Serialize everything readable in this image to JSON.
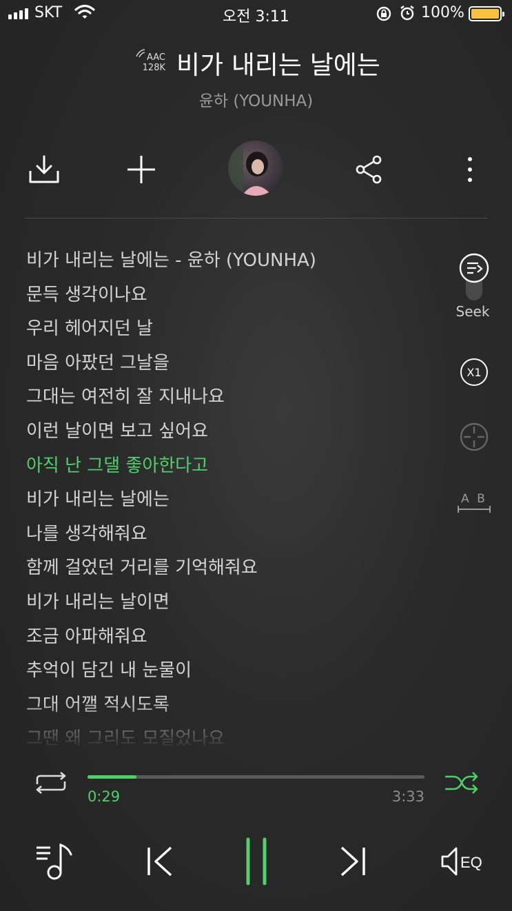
{
  "status_bar": {
    "carrier": "SKT",
    "time": "오전 3:11",
    "battery_percent": "100%",
    "battery_level": 1.0
  },
  "header": {
    "codec_line1": "AAC",
    "codec_line2": "128K",
    "title": "비가 내리는 날에는",
    "artist": "윤하 (YOUNHA)"
  },
  "toolbar": {
    "icons": [
      "download-icon",
      "add-icon",
      "album-art",
      "share-icon",
      "more-icon"
    ]
  },
  "lyrics": {
    "lines": [
      "비가 내리는 날에는 - 윤하 (YOUNHA)",
      "문득 생각이나요",
      "우리 헤어지던 날",
      "마음 아팠던 그날을",
      "그대는 여전히 잘 지내나요",
      "이런 날이면 보고 싶어요",
      "아직 난 그댈 좋아한다고",
      "비가 내리는 날에는",
      "나를 생각해줘요",
      "함께 걸었던 거리를 기억해줘요",
      "비가 내리는 날이면",
      "조금 아파해줘요",
      "추억이 담긴 내 눈물이",
      "그대 어깰 적시도록",
      "그땐 왜 그리도 모질었나요"
    ],
    "active_index": 6
  },
  "side_controls": {
    "seek_label": "Seek",
    "speed_label": "X1",
    "ab_label": "A B"
  },
  "player": {
    "elapsed": "0:29",
    "total": "3:33",
    "progress": 0.146
  },
  "colors": {
    "accent": "#4fd06a",
    "background": "#2a2a2a",
    "battery": "#f5c342"
  }
}
